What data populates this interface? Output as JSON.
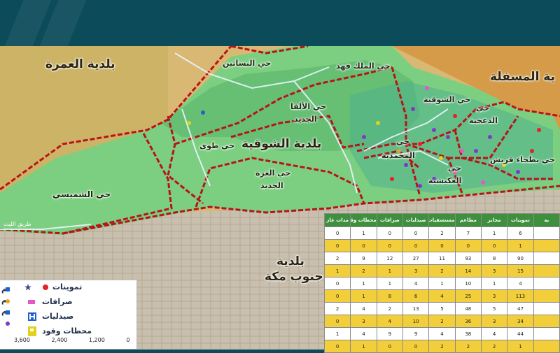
{
  "regions": {
    "omra": "بلدية العمرة",
    "shoqia": "بلدية الشوقية",
    "masfala": "ية المسفلة",
    "south_line1": "بلدية",
    "south_line2": "جنوب مكة"
  },
  "districts": {
    "basateen": "حي البساتين",
    "king_fahd": "حي الملك فهد",
    "shoqia": "حي الشوقية",
    "nasim_line1": "حي",
    "nasim_line2": "الدعجية",
    "awali": "حي العوالي",
    "tuwa": "حي طوى",
    "alfa_line1": "حي الألفا",
    "alfa_line2": "الجديد",
    "mohammadiya_line1": "حي",
    "mohammadiya_line2": "المحمدية",
    "azizia_line1": "حي",
    "azizia_line2": "العكيشية",
    "batha": "حي بطحاء قريش",
    "ghazza_line1": "حي الغزة",
    "ghazza_line2": "الجديد",
    "shumaisi": "حي الشميسي"
  },
  "road_label": "طريق الليث",
  "legend": {
    "tamwinat": "تموينات",
    "sarrafat": "صرافات",
    "saydaliyat": "صيدليات",
    "fuel": "محطات وقود",
    "cut1": "م",
    "cut2": "م",
    "cut3": "م",
    "colors": {
      "tamwinat": "#e8202a",
      "sarrafat": "#e855c8",
      "saydaliyat": "#1e64c8",
      "fuel": "#e3d21a",
      "star": "#3a4a8a",
      "dot_orange": "#f0a020",
      "dot_purple": "#7a3cc8"
    }
  },
  "scale_ticks": [
    "3,600",
    "2,400",
    "1,200",
    "0"
  ],
  "table": {
    "headers": [
      "مدات غاز",
      "محطات وقود",
      "صرافات",
      "صيدليات",
      "مستشفيات",
      "مطاعم",
      "مخابز",
      "تموينات",
      "ية"
    ],
    "rows": [
      [
        "0",
        "1",
        "0",
        "0",
        "2",
        "7",
        "1",
        "6",
        ""
      ],
      [
        "0",
        "0",
        "0",
        "0",
        "0",
        "0",
        "0",
        "1",
        ""
      ],
      [
        "2",
        "9",
        "12",
        "27",
        "11",
        "93",
        "8",
        "90",
        ""
      ],
      [
        "1",
        "2",
        "1",
        "3",
        "2",
        "14",
        "3",
        "15",
        ""
      ],
      [
        "0",
        "1",
        "1",
        "4",
        "1",
        "10",
        "1",
        "4",
        ""
      ],
      [
        "0",
        "1",
        "8",
        "6",
        "4",
        "25",
        "3",
        "113",
        ""
      ],
      [
        "2",
        "4",
        "2",
        "13",
        "5",
        "48",
        "5",
        "47",
        ""
      ],
      [
        "0",
        "3",
        "4",
        "10",
        "2",
        "36",
        "3",
        "34",
        ""
      ],
      [
        "1",
        "4",
        "9",
        "9",
        "4",
        "38",
        "4",
        "44",
        ""
      ],
      [
        "0",
        "1",
        "0",
        "0",
        "2",
        "2",
        "2",
        "1",
        ""
      ]
    ]
  }
}
